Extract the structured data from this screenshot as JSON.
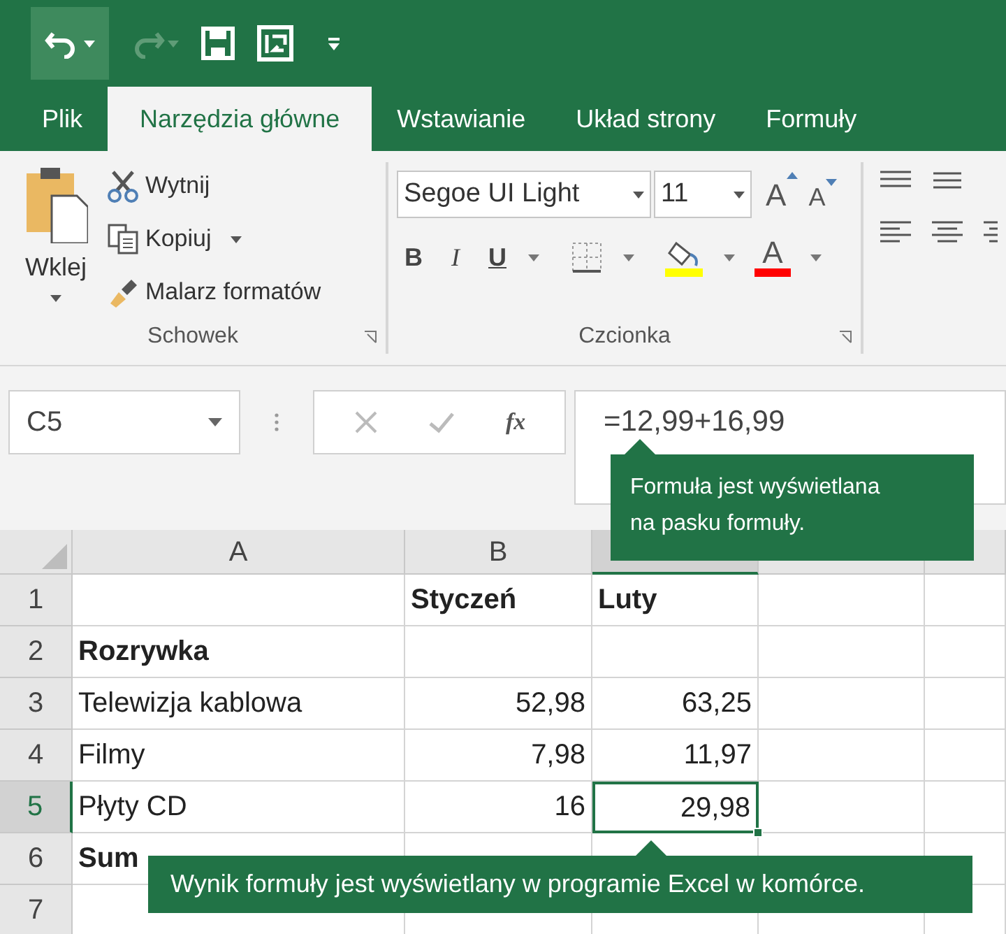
{
  "tabs": [
    {
      "label": "Plik",
      "selected": false
    },
    {
      "label": "Narzędzia główne",
      "selected": true
    },
    {
      "label": "Wstawianie",
      "selected": false
    },
    {
      "label": "Układ strony",
      "selected": false
    },
    {
      "label": "Formuły",
      "selected": false
    }
  ],
  "clipboard": {
    "paste": "Wklej",
    "items": [
      {
        "kind": "cut",
        "label": "Wytnij"
      },
      {
        "kind": "copy",
        "label": "Kopiuj"
      },
      {
        "kind": "brush",
        "label": "Malarz formatów"
      }
    ],
    "label": "Schowek"
  },
  "font": {
    "name": "Segoe UI Light",
    "size": "11",
    "grow": "A",
    "shrink": "A",
    "styles": [
      "B",
      "I",
      "U"
    ],
    "color_letter": "A",
    "label": "Czcionka"
  },
  "formula_bar": {
    "name_box": "C5",
    "fx": "fx",
    "formula": "=12,99+16,99"
  },
  "sheet": {
    "columns": [
      {
        "label": "A",
        "selected": false
      },
      {
        "label": "B",
        "selected": false
      },
      {
        "selected": true
      },
      {
        "selected": false
      },
      {
        "selected": false
      }
    ],
    "rows": [
      {
        "number": "1",
        "selected": false,
        "bold": true,
        "cells": [
          "",
          "Styczeń",
          "Luty"
        ]
      },
      {
        "number": "2",
        "selected": false,
        "bold": true,
        "cells": [
          "Rozrywka",
          "",
          ""
        ]
      },
      {
        "number": "3",
        "selected": false,
        "bold": false,
        "cells": [
          "Telewizja kablowa",
          "52,98",
          "63,25"
        ]
      },
      {
        "number": "4",
        "selected": false,
        "bold": false,
        "cells": [
          "Filmy",
          "7,98",
          "11,97"
        ]
      },
      {
        "number": "5",
        "selected": true,
        "bold": false,
        "cells": [
          "Płyty CD",
          "16",
          "29,98"
        ]
      },
      {
        "number": "6",
        "selected": false,
        "bold": true,
        "cells": [
          "Sum",
          "",
          ""
        ]
      },
      {
        "number": "7",
        "selected": false,
        "cells": [
          "",
          "",
          ""
        ]
      }
    ]
  },
  "callouts": [
    {
      "text": "Formuła jest wyświetlana na pasku formuły."
    },
    {
      "text": "Wynik formuły jest wyświetlany w programie Excel w komórce."
    }
  ]
}
